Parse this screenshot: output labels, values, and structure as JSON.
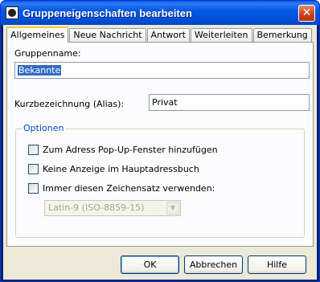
{
  "window": {
    "title": "Gruppeneigenschaften bearbeiten",
    "close_label": "✕"
  },
  "tabs": [
    {
      "label": "Allgemeines",
      "active": true
    },
    {
      "label": "Neue Nachricht",
      "active": false
    },
    {
      "label": "Antwort",
      "active": false
    },
    {
      "label": "Weiterleiten",
      "active": false
    },
    {
      "label": "Bemerkung",
      "active": false
    }
  ],
  "form": {
    "group_name_label": "Gruppenname:",
    "group_name_value": "Bekannte",
    "alias_label": "Kurzbezeichnung (Alias):",
    "alias_value": "Privat"
  },
  "options": {
    "legend": "Optionen",
    "items": [
      {
        "label": "Zum Adress Pop-Up-Fenster hinzufügen",
        "checked": false
      },
      {
        "label": "Keine Anzeige im Hauptadressbuch",
        "checked": false
      },
      {
        "label": "Immer diesen Zeichensatz verwenden:",
        "checked": false
      }
    ],
    "charset_value": "Latin-9 (ISO-8859-15)",
    "charset_enabled": false
  },
  "buttons": {
    "ok": "OK",
    "cancel": "Abbrechen",
    "help": "Hilfe"
  },
  "colors": {
    "titlebar": "#0058e6",
    "dialog_bg": "#ece9d8",
    "legend_text": "#0046d5",
    "selection": "#316ac5",
    "active_tab_accent": "#ffc83c"
  }
}
